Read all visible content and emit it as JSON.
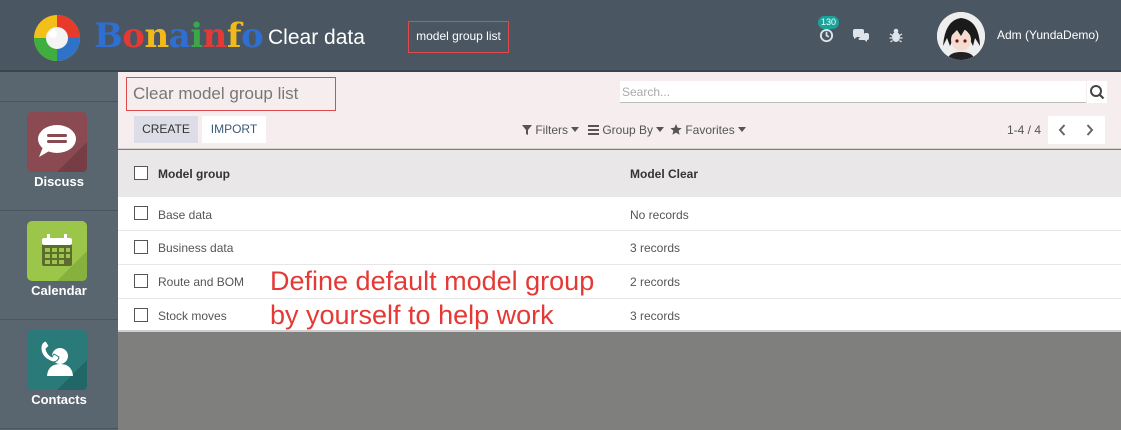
{
  "topbar": {
    "brand": "Bonainfo",
    "app_title": "Clear data",
    "breadcrumb": "model group list",
    "activity_badge": "130",
    "user_name": "Adm (YundaDemo)",
    "icons": [
      "clock-icon",
      "chat-icon",
      "bug-icon"
    ]
  },
  "sidebar": {
    "apps": [
      {
        "label": "Discuss",
        "icon": "chat-bubble-icon",
        "color": "#8b4a52"
      },
      {
        "label": "Calendar",
        "icon": "calendar-icon",
        "color": "#9cc64a"
      },
      {
        "label": "Contacts",
        "icon": "contacts-icon",
        "color": "#2a7a7a"
      }
    ]
  },
  "panel": {
    "title": "Clear model group list",
    "search_placeholder": "Search...",
    "create_label": "CREATE",
    "import_label": "IMPORT",
    "filters_label": "Filters",
    "group_by_label": "Group By",
    "favorites_label": "Favorites",
    "pager": "1-4 / 4"
  },
  "table": {
    "columns": [
      "Model group",
      "Model Clear"
    ],
    "rows": [
      {
        "group": "Base data",
        "clear": "No records"
      },
      {
        "group": "Business data",
        "clear": "3 records"
      },
      {
        "group": "Route and BOM",
        "clear": "2 records"
      },
      {
        "group": "Stock moves",
        "clear": "3 records"
      }
    ]
  },
  "annotation": {
    "line1": "Define default model group",
    "line2": "by yourself to help work"
  },
  "colors": {
    "topbar": "#4a5661",
    "sidebar": "#596670",
    "highlight_box": "#e14a4a",
    "annotation_text": "#e53935"
  }
}
